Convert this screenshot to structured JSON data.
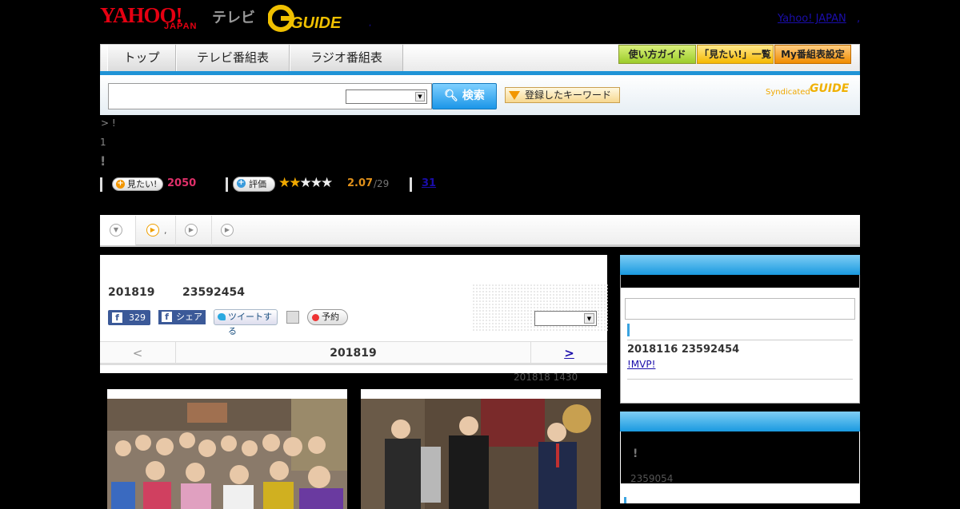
{
  "header": {
    "logo_yahoo": "YAHOO!",
    "logo_japan": "JAPAN",
    "logo_tv": "テレビ",
    "logo_gguide": "G GUIDE",
    "yahoo_japan_link": "Yahoo! JAPAN",
    "trailing_dot": ",",
    "small_dot": ","
  },
  "nav": {
    "tabs": [
      "トップ",
      "テレビ番組表",
      "ラジオ番組表"
    ],
    "guide_button": "使い方ガイド",
    "mitai_list_button": "「見たい!」一覧",
    "my_schedule_button": "My番組表設定"
  },
  "search": {
    "input_value": "",
    "select_value": "",
    "button_label": "検索",
    "keywords_button": "登録したキーワード",
    "syndicated": "Syndicated",
    "gguide_small": "GUIDE"
  },
  "program": {
    "breadcrumb": "> !",
    "line1": "1",
    "line2": "!",
    "mitai_label": "見たい!",
    "mitai_count": "2050",
    "hyoka_label": "評価",
    "rating": 2.07,
    "rating_text": "2.07",
    "rating_total": "/29",
    "review_link": "31"
  },
  "tabs": {
    "tab2_label": ","
  },
  "episode": {
    "date": "201819",
    "number": "23592454",
    "facebook_count": "329",
    "share_label": "シェア",
    "tweet_label": "ツイートする",
    "reserve_label": "予約",
    "select_value": "",
    "prev": "<",
    "nav_date": "201819",
    "next": ">",
    "air_time": "201818  1430"
  },
  "sidebar": {
    "news_date": "2018116  23592454",
    "news_link": "!MVP!",
    "box2_exclaim": "!",
    "box2_number": "2359054"
  },
  "colors": {
    "accent_blue": "#1f93d6",
    "mitai_pink": "#e0306a",
    "star_orange": "#f0a800",
    "facebook_blue": "#3b5998"
  }
}
